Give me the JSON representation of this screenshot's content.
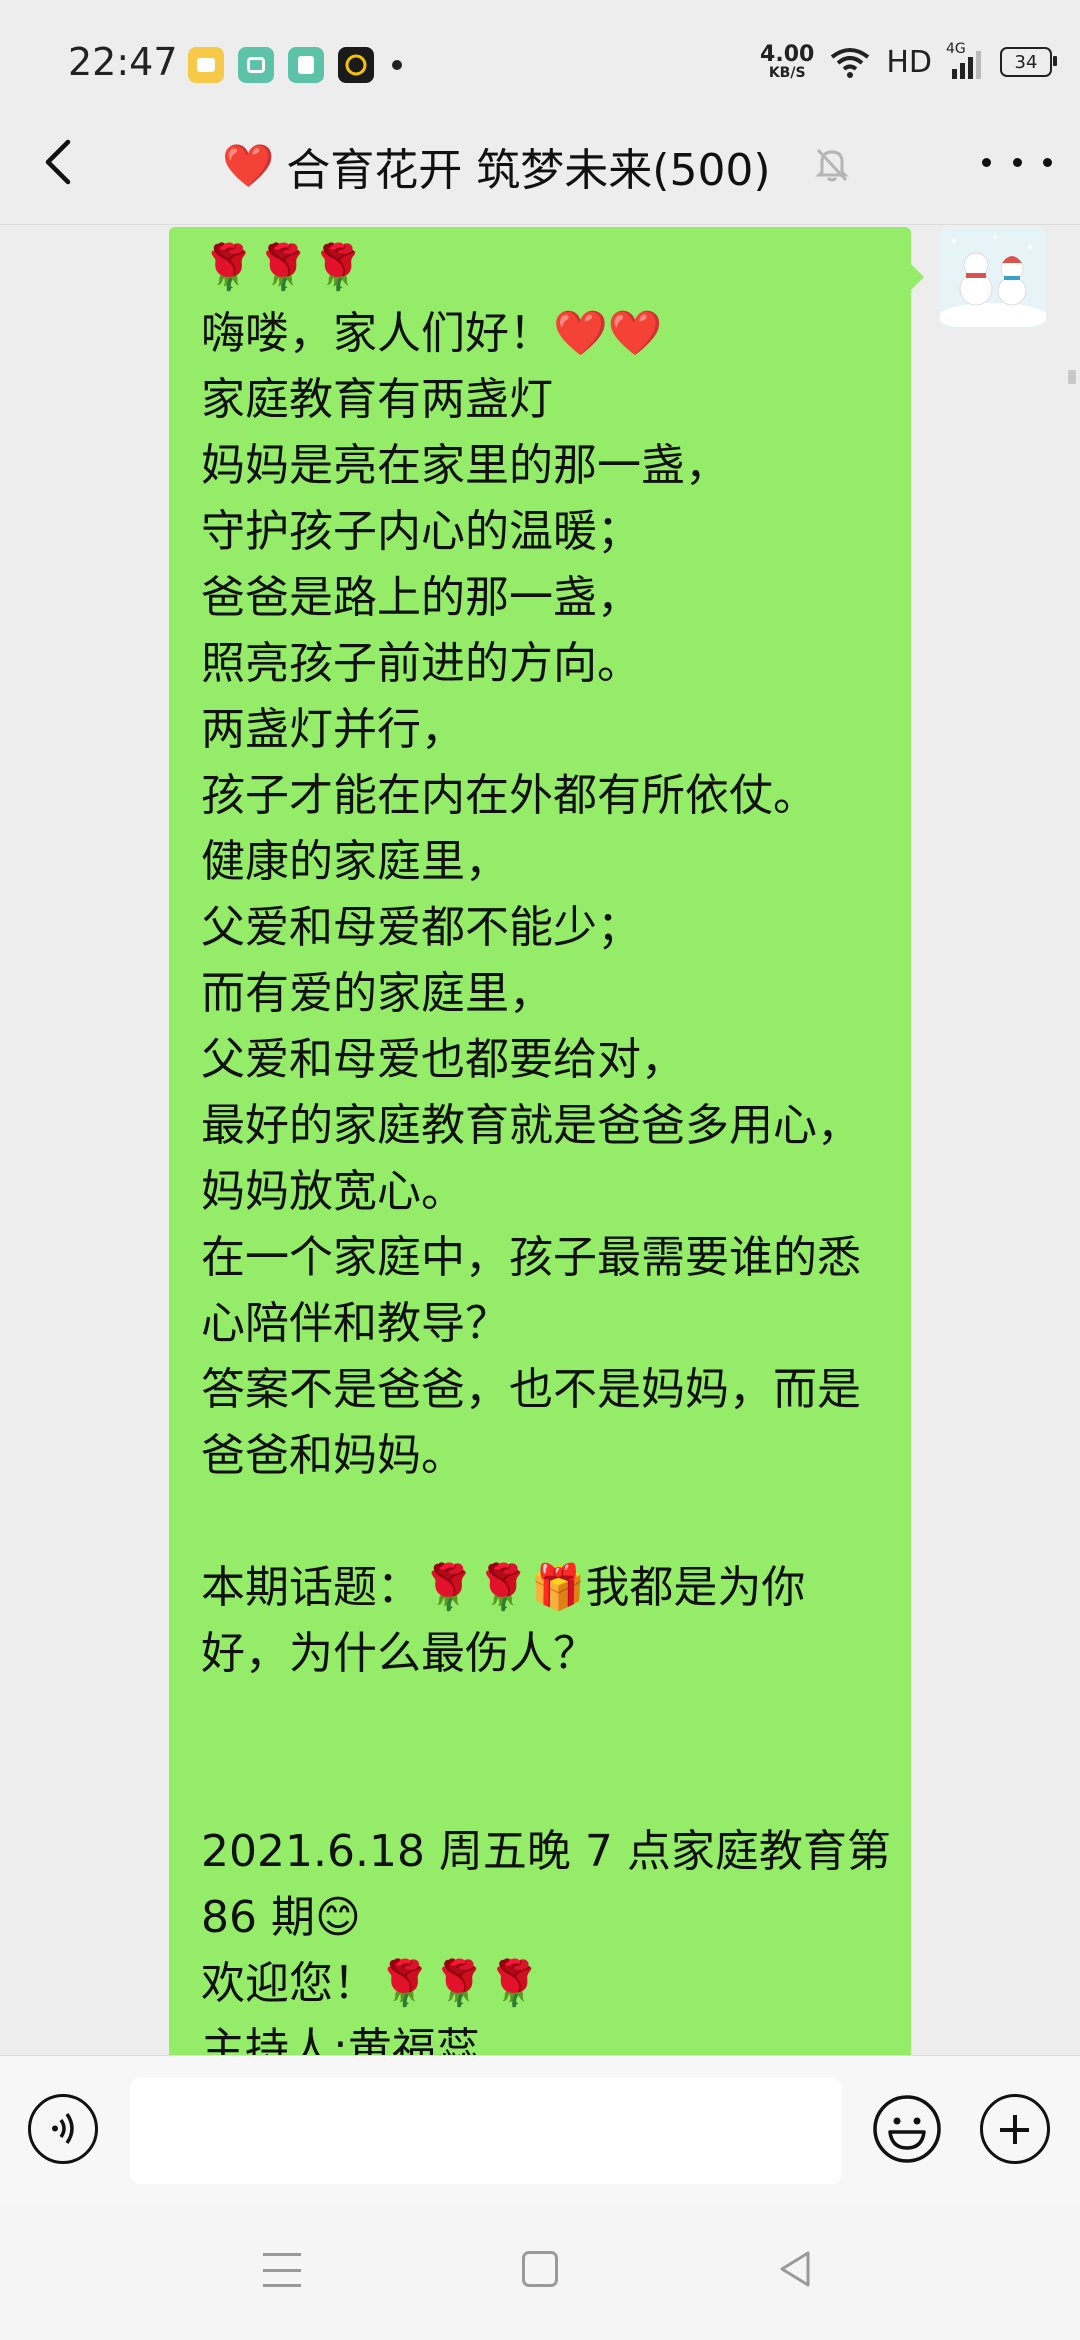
{
  "status_bar": {
    "time": "22:47",
    "network_speed_value": "4.00",
    "network_speed_unit": "KB/S",
    "hd_label": "HD",
    "signal_label": "4G",
    "battery": "34"
  },
  "header": {
    "heart_emoji": "❤️",
    "title": "合育花开 筑梦未来(500)"
  },
  "message": {
    "text": "🌹🌹🌹\n嗨喽，家人们好！❤️❤️\n家庭教育有两盏灯\n妈妈是亮在家里的那一盏，\n守护孩子内心的温暖；\n爸爸是路上的那一盏，\n照亮孩子前进的方向。\n两盏灯并行，\n孩子才能在内在外都有所依仗。\n健康的家庭里，\n父爱和母爱都不能少；\n而有爱的家庭里，\n父爱和母爱也都要给对，\n最好的家庭教育就是爸爸多用心，\n妈妈放宽心。\n在一个家庭中，孩子最需要谁的悉心陪伴和教导？\n答案不是爸爸，也不是妈妈，而是爸爸和妈妈。\n\n本期话题：🌹🌹🎁我都是为你好，为什么最伤人？\n\n\n2021.6.18 周五晚 7 点家庭教育第 86 期😊\n欢迎您！🌹🌹🌹\n主持人:黄福蕊"
  },
  "input": {
    "value": "",
    "placeholder": ""
  },
  "colors": {
    "bubble": "#95ec69",
    "background": "#ededed"
  }
}
